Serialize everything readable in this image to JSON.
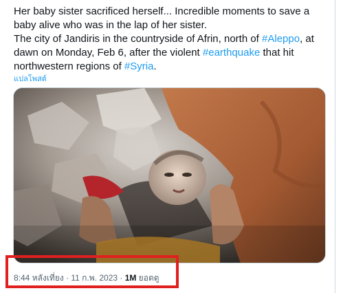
{
  "tweet": {
    "line1": "Her baby sister sacrificed herself... Incredible moments to save a baby alive who was in the lap of her sister.",
    "line2_prefix": "The city of Jandiris in the countryside of Afrin, north of ",
    "hashtag_aleppo": "#Aleppo",
    "line2_mid": ", at dawn on Monday, Feb 6, after the violent ",
    "hashtag_earthquake": "#earthquake",
    "line2_mid2": " that hit northwestern regions of ",
    "hashtag_syria": "#Syria",
    "line2_suffix": ".",
    "translate_label": "แปลโพสต์"
  },
  "meta": {
    "time": "8:44 หลังเที่ยง",
    "separator": " · ",
    "date": "11 ก.พ. 2023",
    "views_count": "1M",
    "views_label": " ยอดดู"
  },
  "colors": {
    "link": "#1d9bf0",
    "highlight": "#e0201f",
    "text": "#0f1419",
    "muted": "#536471"
  }
}
